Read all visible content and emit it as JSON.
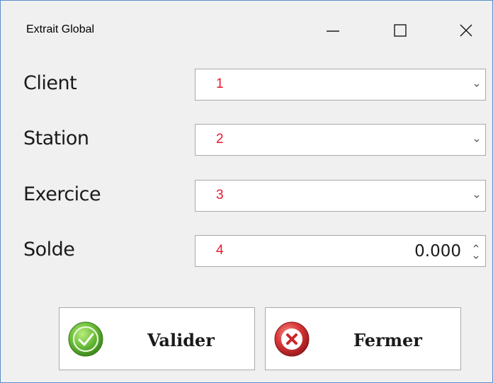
{
  "window": {
    "title": "Extrait Global",
    "controls": {
      "minimize": "minimize-icon",
      "maximize": "maximize-icon",
      "close": "close-icon"
    }
  },
  "form": {
    "fields": [
      {
        "label": "Client",
        "marker": "1",
        "kind": "combobox"
      },
      {
        "label": "Station",
        "marker": "2",
        "kind": "combobox"
      },
      {
        "label": "Exercice",
        "marker": "3",
        "kind": "combobox"
      },
      {
        "label": "Solde",
        "marker": "4",
        "kind": "spinner",
        "value": "0.000"
      }
    ]
  },
  "buttons": {
    "valider": {
      "label": "Valider",
      "icon": "check-circle-icon"
    },
    "fermer": {
      "label": "Fermer",
      "icon": "x-circle-icon"
    }
  },
  "colors": {
    "marker": "#e8192c",
    "window_border": "#5b8fc9",
    "valider_icon": "#6cbf3a",
    "fermer_icon": "#d9383a"
  }
}
